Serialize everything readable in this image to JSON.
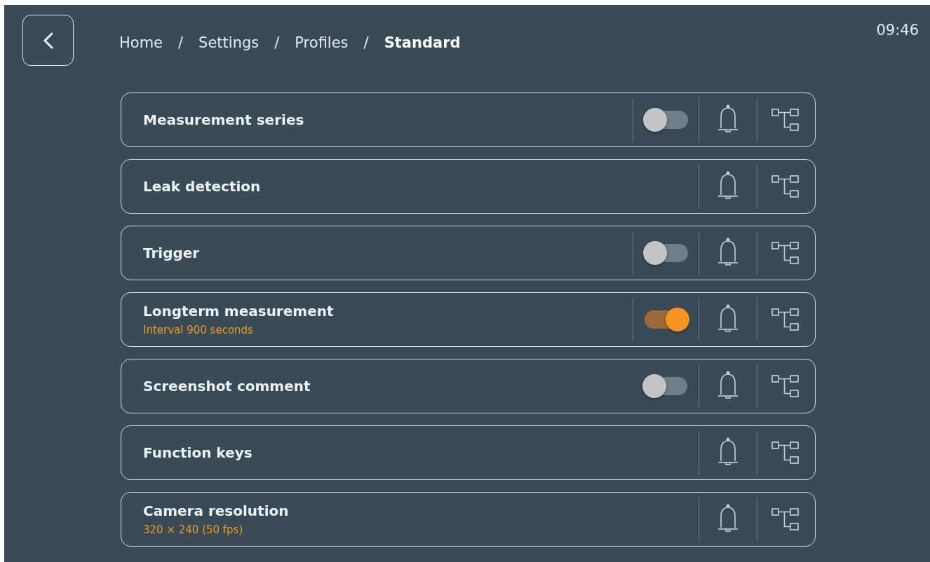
{
  "breadcrumb": [
    {
      "label": "Home",
      "kind": "link"
    },
    {
      "label": "/",
      "kind": "separator"
    },
    {
      "label": "Settings",
      "kind": "link"
    },
    {
      "label": "/",
      "kind": "separator"
    },
    {
      "label": "Profiles",
      "kind": "link"
    },
    {
      "label": "/",
      "kind": "separator"
    },
    {
      "label": "Standard",
      "kind": "current"
    }
  ],
  "time": "09:46",
  "rows": [
    {
      "title": "Measurement series",
      "toggle": {
        "on": false,
        "separated": true
      }
    },
    {
      "title": "Leak detection"
    },
    {
      "title": "Trigger",
      "toggle": {
        "on": false,
        "separated": true
      }
    },
    {
      "title": "Longterm measurement",
      "subtitle": "Interval 900 seconds",
      "toggle": {
        "on": true,
        "separated": true
      }
    },
    {
      "title": "Screenshot comment",
      "toggle": {
        "on": false,
        "separated": false
      }
    },
    {
      "title": "Function keys"
    },
    {
      "title": "Camera resolution",
      "subtitle": "320 × 240 (50 fps)"
    }
  ]
}
